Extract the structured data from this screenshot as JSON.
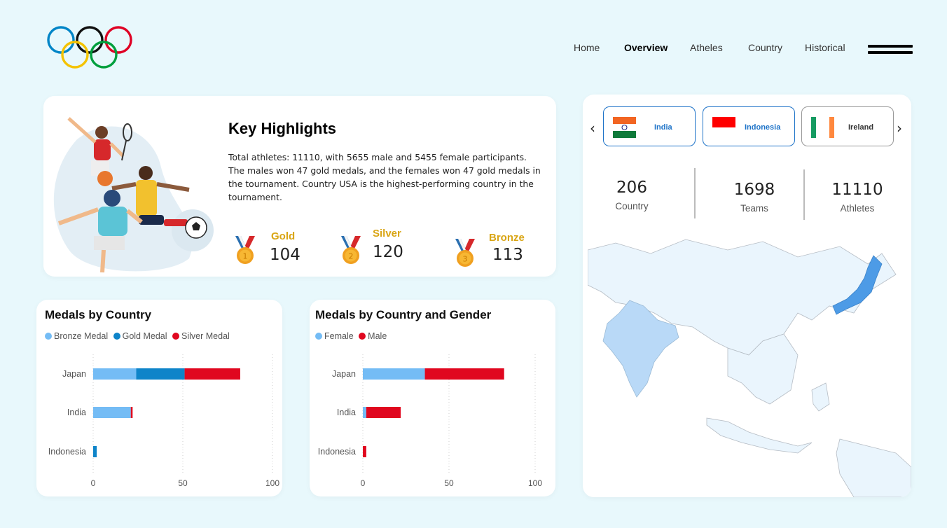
{
  "nav": {
    "items": [
      "Home",
      "Overview",
      "Atheles",
      "Country",
      "Historical"
    ],
    "active": "Overview"
  },
  "key_highlights": {
    "title": "Key Highlights",
    "text": "Total athletes: 11110, with 5655 male and 5455 female participants. The males won 47 gold medals, and the females won 47 gold medals in the tournament. Country USA is the highest-performing country in the tournament.",
    "medals": [
      {
        "label": "Gold",
        "value": "104",
        "rank": "1"
      },
      {
        "label": "Silver",
        "value": "120",
        "rank": "2"
      },
      {
        "label": "Bronze",
        "value": "113",
        "rank": "3"
      }
    ]
  },
  "countries": [
    {
      "name": "India",
      "color": "#1e73c8"
    },
    {
      "name": "Indonesia",
      "color": "#1e73c8"
    },
    {
      "name": "Ireland",
      "color": "#333333"
    }
  ],
  "stats": [
    {
      "value": "206",
      "label": "Country"
    },
    {
      "value": "1698",
      "label": "Teams"
    },
    {
      "value": "11110",
      "label": "Athletes"
    }
  ],
  "colors": {
    "bronze_medal": "#74bcf5",
    "gold_medal": "#0e84c9",
    "silver_medal": "#e0071f",
    "female": "#74bcf5",
    "male": "#e0071f",
    "medal_label": "#d9a514",
    "map_highlight_japan": "#4d9be6",
    "map_highlight_india": "#b9d9f7"
  },
  "chart_data": [
    {
      "type": "bar",
      "orientation": "horizontal",
      "stacked": true,
      "title": "Medals by Country",
      "categories": [
        "Japan",
        "India",
        "Indonesia"
      ],
      "series": [
        {
          "name": "Bronze Medal",
          "values": [
            24,
            21,
            0
          ]
        },
        {
          "name": "Gold Medal",
          "values": [
            27,
            0,
            2
          ]
        },
        {
          "name": "Silver Medal",
          "values": [
            31,
            1,
            0
          ]
        }
      ],
      "xlim": [
        0,
        100
      ],
      "xticks": [
        "0",
        "50",
        "100"
      ],
      "grid": true,
      "legend": "top-left"
    },
    {
      "type": "bar",
      "orientation": "horizontal",
      "stacked": true,
      "title": "Medals by Country and Gender",
      "categories": [
        "Japan",
        "India",
        "Indonesia"
      ],
      "series": [
        {
          "name": "Female",
          "values": [
            36,
            2,
            0
          ]
        },
        {
          "name": "Male",
          "values": [
            46,
            20,
            2
          ]
        }
      ],
      "xlim": [
        0,
        100
      ],
      "xticks": [
        "0",
        "50",
        "100"
      ],
      "grid": true,
      "legend": "top-left"
    }
  ]
}
